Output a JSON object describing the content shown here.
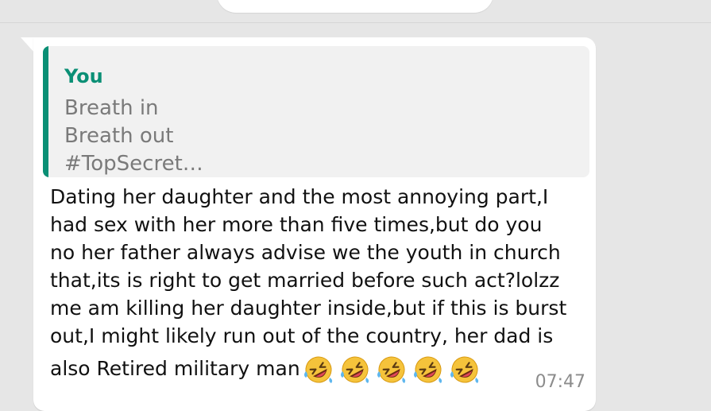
{
  "quote": {
    "author": "You",
    "lines": [
      "Breath in",
      "Breath out",
      "#TopSecret…"
    ]
  },
  "message": {
    "lines": [
      "Dating her daughter and the most annoying part,I",
      "had sex with her more than five times,but do you",
      "no her father always advise we the youth in church",
      "that,its is right to get married before such act?lolzz",
      "me am killing her daughter inside,but if this is burst",
      "out,I might likely run out of the country, her dad is",
      "also Retired military man"
    ],
    "emoji": "rolling-on-the-floor-laughing-emoji",
    "emoji_count": 5,
    "time": "07:47"
  },
  "colors": {
    "background": "#e6e6e6",
    "bubble": "#ffffff",
    "quote_background": "#f1f1f1",
    "quote_accent": "#0a8f75",
    "quote_text": "#7a7a7a",
    "message_text": "#111111",
    "time_text": "#8c8c8c"
  }
}
